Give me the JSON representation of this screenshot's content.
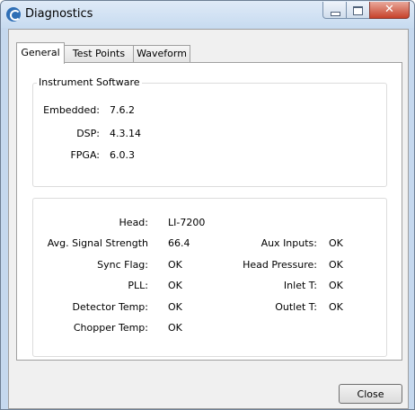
{
  "window": {
    "title": "Diagnostics"
  },
  "tabs": [
    {
      "label": "General",
      "active": true
    },
    {
      "label": "Test Points",
      "active": false
    },
    {
      "label": "Waveform",
      "active": false
    }
  ],
  "software": {
    "title": "Instrument Software",
    "rows": [
      {
        "label": "Embedded:",
        "value": "7.6.2"
      },
      {
        "label": "DSP:",
        "value": "4.3.14"
      },
      {
        "label": "FPGA:",
        "value": "6.0.3"
      }
    ]
  },
  "head_info": {
    "left": [
      {
        "label": "Head:",
        "value": "LI-7200"
      },
      {
        "label": "Avg. Signal Strength",
        "value": "66.4"
      },
      {
        "label": "Sync Flag:",
        "value": "OK"
      },
      {
        "label": "PLL:",
        "value": "OK"
      },
      {
        "label": "Detector Temp:",
        "value": "OK"
      },
      {
        "label": "Chopper Temp:",
        "value": "OK"
      }
    ],
    "right": [
      {
        "label": "Aux Inputs:",
        "value": "OK"
      },
      {
        "label": "Head Pressure:",
        "value": "OK"
      },
      {
        "label": "Inlet T:",
        "value": "OK"
      },
      {
        "label": "Outlet T:",
        "value": "OK"
      }
    ]
  },
  "buttons": {
    "close": "Close"
  }
}
